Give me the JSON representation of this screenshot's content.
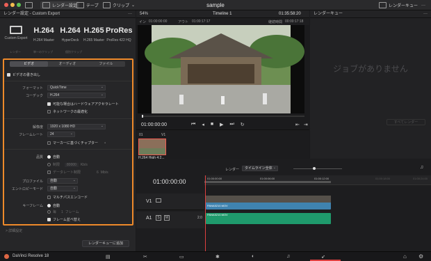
{
  "window": {
    "title": "sample"
  },
  "toolbar": {
    "render_settings": "レンダー設定",
    "tape": "テープ",
    "clip": "クリップ",
    "render_queue": "レンダーキュー"
  },
  "header": {
    "left_title": "レンダー設定 - Custom Export",
    "zoom": "54%",
    "timeline": "Timeline 1",
    "timecode": "01:35:58:20",
    "queue_title": "レンダーキュー"
  },
  "presets": [
    {
      "big": "",
      "small": "Custom Export"
    },
    {
      "big": "H.264",
      "small": "H.264 Master"
    },
    {
      "big": "H.264",
      "small": "HyperDeck"
    },
    {
      "big": "H.265",
      "small": "H.265 Master"
    },
    {
      "big": "ProRes",
      "small": "ProRes 422 HQ"
    }
  ],
  "presets_row2": {
    "a": "レンダー",
    "b": "単一のクリップ",
    "c": "個別クリップ"
  },
  "tabs": [
    "ビデオ",
    "オーディオ",
    "ファイル"
  ],
  "video": {
    "export_video": "ビデオの書き出し",
    "format_label": "フォーマット",
    "format_value": "QuickTime",
    "codec_label": "コーデック",
    "codec_value": "H.264",
    "hw_accel": "可能な場合はハードウェアアクセラレート",
    "network": "ネットワークの最適化",
    "resolution_label": "解像度",
    "resolution_value": "1920 x 1080 HD",
    "framerate_label": "フレームレート",
    "framerate_value": "24",
    "chapter": "マーカーに基づくチャプター",
    "quality_label": "品質",
    "auto": "自動",
    "limit": "制限",
    "limit_value": "80000",
    "kbs": "Kb/s",
    "data_rate": "データレート制限",
    "data_rate_value": "6",
    "mbs": "Mb/s",
    "profile_label": "プロファイル",
    "profile_value": "自動",
    "entropy_label": "エントロピーモード",
    "entropy_value": "自動",
    "multipass": "マルチパスエンコード",
    "keyframe_label": "キーフレーム",
    "keyframe_auto": "自動",
    "keyframe_every": "毎",
    "keyframe_num": "1",
    "keyframe_unit": "フレーム",
    "frame_reorder": "フレーム並べ替え"
  },
  "advanced": "> 詳細設定",
  "add_queue": "レンダーキューに追加",
  "viewer": {
    "tc_in_label": "イン",
    "tc_in": "01:00:00:00",
    "tc_out_label": "アウト",
    "tc_out": "01:00:17:17",
    "dur_label": "継続時間",
    "dur": "00:00:17:18",
    "current_tc": "01:00:00:00"
  },
  "queue": {
    "empty": "ジョブがありません",
    "render_all": "すべてレンダー"
  },
  "clips": {
    "num": "01",
    "track": "V1",
    "name": "H.264 High 4:2..."
  },
  "timeline": {
    "render_label": "レンダー",
    "render_value": "タイムライン全体",
    "tc": "01:00:00:00",
    "ruler": [
      "01:00:00:00",
      "01:00:06:00",
      "01:00:12:00",
      "01:00:18:00",
      "01:00:24:00"
    ],
    "v1": "V1",
    "a1": "A1",
    "a1_level": "2.0",
    "video_clip": "PANA5210.MOV",
    "audio_clip": "PANA5210.MOV"
  },
  "footer": {
    "app": "DaVinci Resolve 18"
  },
  "colors": {
    "accent": "#ef8a2a",
    "video_track": "#3f83b0",
    "audio_track": "#1f9a6c",
    "playhead": "#e04040"
  }
}
